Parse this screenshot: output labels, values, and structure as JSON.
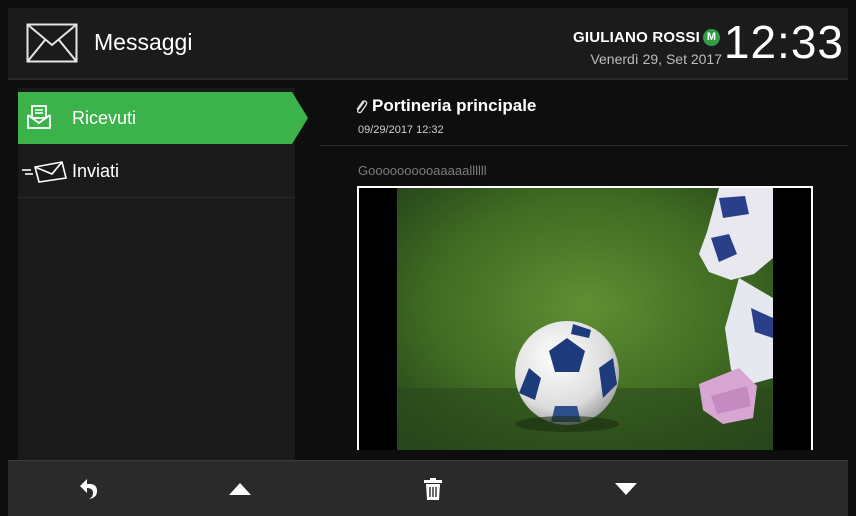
{
  "header": {
    "title": "Messaggi",
    "user_name": "GIULIANO ROSSI",
    "user_badge": "M",
    "date": "Venerdì 29, Set 2017",
    "time": "12:33"
  },
  "sidebar": {
    "items": [
      {
        "label": "Ricevuti",
        "icon": "inbox-icon",
        "active": true
      },
      {
        "label": "Inviati",
        "icon": "sent-envelope-icon",
        "active": false
      }
    ]
  },
  "message": {
    "subject": "Portineria principale",
    "date": "09/29/2017 12:32",
    "body": "Goooooooooaaaaallllll",
    "has_attachment": true,
    "attachment_icon": "paperclip-icon"
  },
  "toolbar": {
    "buttons": [
      {
        "name": "reply",
        "icon": "reply-icon"
      },
      {
        "name": "up",
        "icon": "arrow-up-icon"
      },
      {
        "name": "delete",
        "icon": "trash-icon"
      },
      {
        "name": "down",
        "icon": "arrow-down-icon"
      }
    ]
  },
  "colors": {
    "accent": "#3bb34a",
    "badge": "#2f9e44",
    "background": "#0e0e0e",
    "panel": "#1a1a1a",
    "toolbar": "#2a2a2a"
  }
}
